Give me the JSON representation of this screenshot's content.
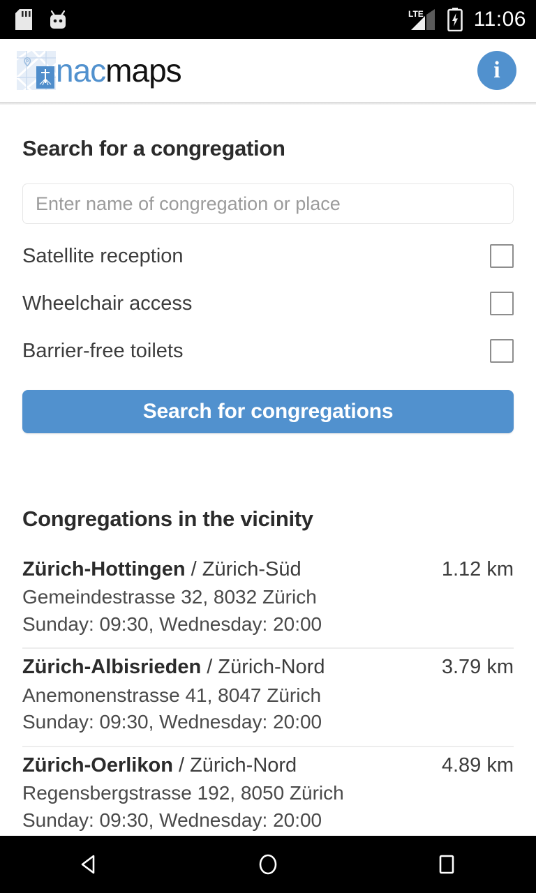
{
  "status_bar": {
    "icons": [
      "sd-card-icon",
      "android-icon",
      "lte-signal-icon",
      "battery-charging-icon"
    ],
    "network": "LTE",
    "time": "11:06",
    "background": "#000000"
  },
  "header": {
    "logo_icon": "nacmaps-map-logo-icon",
    "brand_first": "nac",
    "brand_second": "maps",
    "brand_accent_color": "#5191ce",
    "info_button_label": "i",
    "info_button_name": "info-icon"
  },
  "search": {
    "title": "Search for a congregation",
    "placeholder": "Enter name of congregation or place",
    "value": "",
    "options": [
      {
        "label": "Satellite reception",
        "checked": false
      },
      {
        "label": "Wheelchair access",
        "checked": false
      },
      {
        "label": "Barrier-free toilets",
        "checked": false
      }
    ],
    "submit_label": "Search for congregations",
    "submit_color": "#5191ce"
  },
  "vicinity": {
    "title": "Congregations in the vicinity",
    "results": [
      {
        "name": "Zürich-Hottingen",
        "separator": " / ",
        "district": "Zürich-Süd",
        "distance": "1.12 km",
        "address": "Gemeindestrasse 32, 8032 Zürich",
        "times": "Sunday: 09:30, Wednesday: 20:00"
      },
      {
        "name": "Zürich-Albisrieden",
        "separator": " / ",
        "district": "Zürich-Nord",
        "distance": "3.79 km",
        "address": "Anemonenstrasse 41, 8047 Zürich",
        "times": "Sunday: 09:30, Wednesday: 20:00"
      },
      {
        "name": "Zürich-Oerlikon",
        "separator": " / ",
        "district": "Zürich-Nord",
        "distance": "4.89 km",
        "address": "Regensbergstrasse 192, 8050 Zürich",
        "times": "Sunday: 09:30, Wednesday: 20:00"
      }
    ]
  },
  "nav_bar": {
    "back_icon": "back-triangle-icon",
    "home_icon": "home-circle-icon",
    "recents_icon": "recents-square-icon",
    "background": "#000000"
  }
}
